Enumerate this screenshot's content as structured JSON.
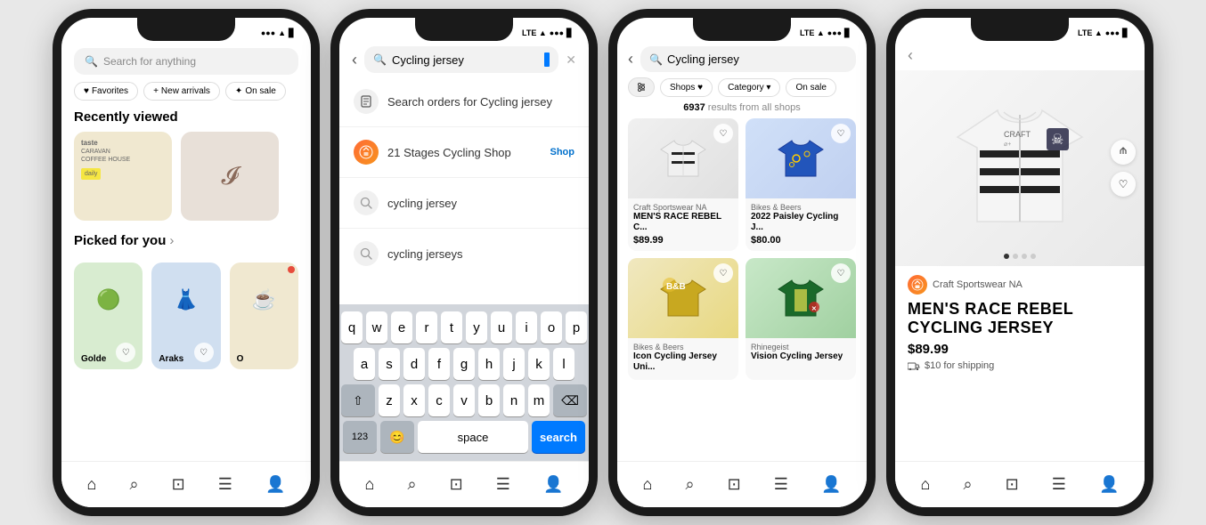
{
  "phones": [
    {
      "id": "phone1",
      "statusBar": {
        "time": "",
        "signal": "●●●●",
        "wifi": "▲",
        "battery": "■"
      },
      "search": {
        "placeholder": "Search for anything"
      },
      "tags": [
        {
          "icon": "♥",
          "label": "Favorites"
        },
        {
          "icon": "+",
          "label": "New arrivals"
        },
        {
          "icon": "✦",
          "label": "On sale"
        }
      ],
      "recentlyViewed": {
        "title": "Recently viewed",
        "products": [
          {
            "label": "",
            "bg": "img-caravan"
          },
          {
            "label": "",
            "bg": "img-brush"
          }
        ]
      },
      "pickedForYou": {
        "title": "Picked for you",
        "arrow": "›",
        "products": [
          {
            "label": "Golde",
            "bg": "img-green"
          },
          {
            "label": "Araks",
            "bg": "img-dress"
          },
          {
            "label": "O",
            "bg": "img-caravan",
            "hasDot": true
          }
        ]
      },
      "bottomNav": [
        "⌂",
        "⌕",
        "⊠",
        "☰",
        "👤"
      ]
    },
    {
      "id": "phone2",
      "statusBar": {
        "lte": "LTE ▲▲",
        "signal": "●●●●",
        "battery": "■"
      },
      "searchText": "Cycling jersey",
      "suggestions": [
        {
          "type": "orders",
          "icon": "📦",
          "text": "Search orders for Cycling jersey"
        },
        {
          "type": "shop",
          "icon": "shop",
          "shopName": "21 Stages Cycling Shop",
          "tag": "Shop"
        },
        {
          "type": "search",
          "icon": "🔍",
          "text": "cycling jersey"
        },
        {
          "type": "search",
          "icon": "🔍",
          "text": "cycling jerseys"
        }
      ],
      "keyboard": {
        "rows": [
          [
            "q",
            "w",
            "e",
            "r",
            "t",
            "y",
            "u",
            "i",
            "o",
            "p"
          ],
          [
            "a",
            "s",
            "d",
            "f",
            "g",
            "h",
            "j",
            "k",
            "l"
          ],
          [
            "⇧",
            "z",
            "x",
            "c",
            "v",
            "b",
            "n",
            "m",
            "⌫"
          ]
        ],
        "bottomRow": {
          "num": "123",
          "emoji": "😊",
          "space": "space",
          "search": "search"
        }
      },
      "bottomNav": [
        "⌂",
        "⌕",
        "⊠",
        "☰",
        "👤"
      ]
    },
    {
      "id": "phone3",
      "statusBar": {
        "lte": "LTE ▲▲",
        "signal": "●●●●",
        "battery": "■"
      },
      "searchText": "Cycling jersey",
      "filters": [
        {
          "label": "⊟ Shops ♥",
          "active": true
        },
        {
          "label": "Category ▾"
        },
        {
          "label": "On sale"
        }
      ],
      "results": {
        "count": "6937",
        "suffix": "results from all shops"
      },
      "products": [
        {
          "shop": "Craft Sportswear NA",
          "name": "MEN'S RACE REBEL C...",
          "price": "$89.99",
          "bg": "img-jersey-white"
        },
        {
          "shop": "Bikes & Beers",
          "name": "2022 Paisley Cycling J...",
          "price": "$80.00",
          "bg": "img-jersey-blue"
        },
        {
          "shop": "Bikes & Beers",
          "name": "Icon Cycling Jersey Uni...",
          "price": "",
          "bg": "img-jersey-gold"
        },
        {
          "shop": "Rhinegeist",
          "name": "Vision Cycling Jersey",
          "price": "",
          "bg": "img-jersey-green"
        }
      ],
      "bottomNav": [
        "⌂",
        "⌕",
        "⊠",
        "☰",
        "👤"
      ]
    },
    {
      "id": "phone4",
      "statusBar": {
        "lte": "LTE ▲▲",
        "signal": "●●●●",
        "battery": "■"
      },
      "product": {
        "seller": "Craft Sportswear NA",
        "title": "MEN'S RACE REBEL CYCLING JERSEY",
        "price": "$89.99",
        "shipping": "$10 for shipping",
        "dots": 4,
        "activeDot": 0
      },
      "bottomNav": [
        "⌂",
        "⌕",
        "⊠",
        "☰",
        "👤"
      ]
    }
  ]
}
